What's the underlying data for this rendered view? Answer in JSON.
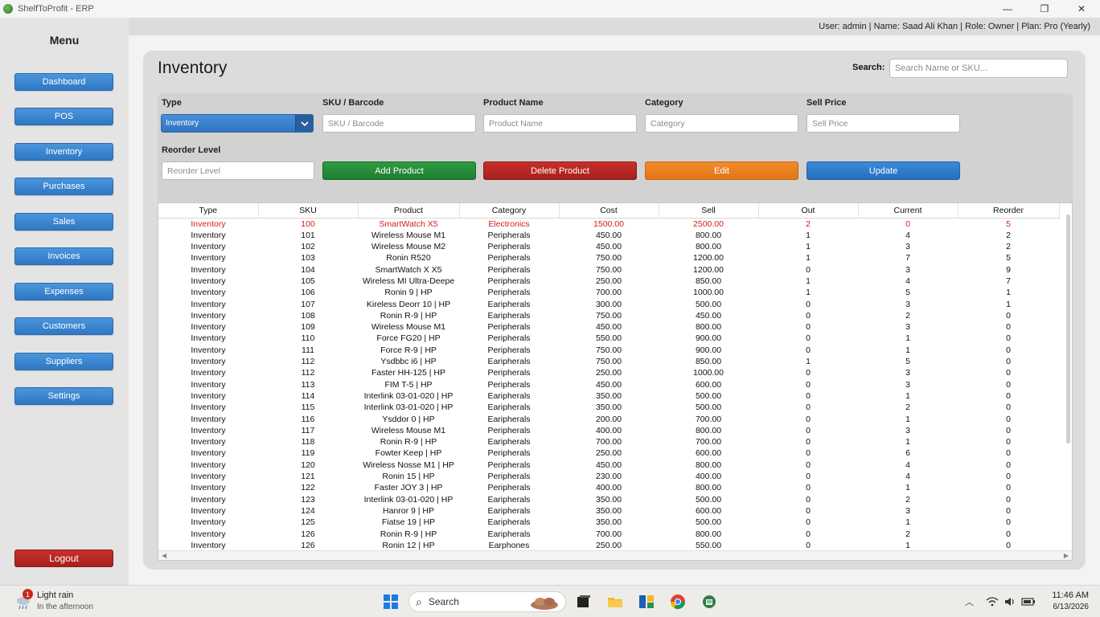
{
  "window": {
    "title": "ShelfToProfit - ERP",
    "min": "—",
    "max": "❐",
    "close": "✕"
  },
  "sidebar": {
    "menu_title": "Menu",
    "items": [
      {
        "label": "Dashboard"
      },
      {
        "label": "POS"
      },
      {
        "label": "Inventory"
      },
      {
        "label": "Purchases"
      },
      {
        "label": "Sales"
      },
      {
        "label": "Invoices"
      },
      {
        "label": "Expenses"
      },
      {
        "label": "Customers"
      },
      {
        "label": "Suppliers"
      },
      {
        "label": "Settings"
      }
    ],
    "logout": "Logout"
  },
  "infobar": {
    "text": "User: admin | Name: Saad Ali Khan | Role: Owner | Plan: Pro (Yearly)"
  },
  "page": {
    "title": "Inventory",
    "search_label": "Search:",
    "search_placeholder": "Search Name or SKU..."
  },
  "form": {
    "type_label": "Type",
    "type_value": "Inventory",
    "sku_label": "SKU / Barcode",
    "sku_placeholder": "SKU / Barcode",
    "name_label": "Product Name",
    "name_placeholder": "Product Name",
    "category_label": "Category",
    "category_placeholder": "Category",
    "sell_label": "Sell Price",
    "sell_placeholder": "Sell Price",
    "reorder_label": "Reorder Level",
    "reorder_placeholder": "Reorder Level",
    "add_label": "Add Product",
    "delete_label": "Delete Product",
    "edit_label": "Edit",
    "update_label": "Update"
  },
  "table": {
    "columns": [
      "Type",
      "SKU",
      "Product",
      "Category",
      "Cost",
      "Sell",
      "Out",
      "Current",
      "Reorder"
    ],
    "rows": [
      [
        "Inventory",
        "100",
        "SmartWatch X5",
        "Electronics",
        "1500.00",
        "2500.00",
        "2",
        "0",
        "5"
      ],
      [
        "Inventory",
        "101",
        "Wireless Mouse M1",
        "Peripherals",
        "450.00",
        "800.00",
        "1",
        "4",
        "2"
      ],
      [
        "Inventory",
        "102",
        "Wireless Mouse M2",
        "Peripherals",
        "450.00",
        "800.00",
        "1",
        "3",
        "2"
      ],
      [
        "Inventory",
        "103",
        "Ronin R520",
        "Peripherals",
        "750.00",
        "1200.00",
        "1",
        "7",
        "5"
      ],
      [
        "Inventory",
        "104",
        "SmartWatch X X5",
        "Peripherals",
        "750.00",
        "1200.00",
        "0",
        "3",
        "9"
      ],
      [
        "Inventory",
        "105",
        "Wireless MI Ultra-Deepe",
        "Peripherals",
        "250.00",
        "850.00",
        "1",
        "4",
        "7"
      ],
      [
        "Inventory",
        "106",
        "Ronin 9 | HP",
        "Peripherals",
        "700.00",
        "1000.00",
        "1",
        "5",
        "1"
      ],
      [
        "Inventory",
        "107",
        "Kireless Deorr 10 | HP",
        "Earipherals",
        "300.00",
        "500.00",
        "0",
        "3",
        "1"
      ],
      [
        "Inventory",
        "108",
        "Ronin R-9 | HP",
        "Earipherals",
        "750.00",
        "450.00",
        "0",
        "2",
        "0"
      ],
      [
        "Inventory",
        "109",
        "Wireless Mouse M1",
        "Peripherals",
        "450.00",
        "800.00",
        "0",
        "3",
        "0"
      ],
      [
        "Inventory",
        "110",
        "Force FG20 | HP",
        "Peripherals",
        "550.00",
        "900.00",
        "0",
        "1",
        "0"
      ],
      [
        "Inventory",
        "111",
        "Force R-9 | HP",
        "Peripherals",
        "750.00",
        "900.00",
        "0",
        "1",
        "0"
      ],
      [
        "Inventory",
        "112",
        "Ysdbbc i6 | HP",
        "Earipherals",
        "750.00",
        "850.00",
        "1",
        "5",
        "0"
      ],
      [
        "Inventory",
        "112",
        "Faster HH-125 | HP",
        "Peripherals",
        "250.00",
        "1000.00",
        "0",
        "3",
        "0"
      ],
      [
        "Inventory",
        "113",
        "FIM T-5 | HP",
        "Peripherals",
        "450.00",
        "600.00",
        "0",
        "3",
        "0"
      ],
      [
        "Inventory",
        "114",
        "Interlink 03-01-020 | HP",
        "Earipherals",
        "350.00",
        "500.00",
        "0",
        "1",
        "0"
      ],
      [
        "Inventory",
        "115",
        "Interlink 03-01-020 | HP",
        "Earipherals",
        "350.00",
        "500.00",
        "0",
        "2",
        "0"
      ],
      [
        "Inventory",
        "116",
        "Ysddor 0 | HP",
        "Earipherals",
        "200.00",
        "700.00",
        "0",
        "1",
        "0"
      ],
      [
        "Inventory",
        "117",
        "Wireless Mouse M1",
        "Peripherals",
        "400.00",
        "800.00",
        "0",
        "3",
        "0"
      ],
      [
        "Inventory",
        "118",
        "Ronin R-9 | HP",
        "Earipherals",
        "700.00",
        "700.00",
        "0",
        "1",
        "0"
      ],
      [
        "Inventory",
        "119",
        "Fowter Keep | HP",
        "Peripherals",
        "250.00",
        "600.00",
        "0",
        "6",
        "0"
      ],
      [
        "Inventory",
        "120",
        "Wireless Nosse M1 | HP",
        "Peripherals",
        "450.00",
        "800.00",
        "0",
        "4",
        "0"
      ],
      [
        "Inventory",
        "121",
        "Ronin 15 | HP",
        "Peripherals",
        "230.00",
        "400.00",
        "0",
        "4",
        "0"
      ],
      [
        "Inventory",
        "122",
        "Faster JOY 3 | HP",
        "Peripherals",
        "400.00",
        "800.00",
        "0",
        "1",
        "0"
      ],
      [
        "Inventory",
        "123",
        "Interlink 03-01-020 | HP",
        "Earipherals",
        "350.00",
        "500.00",
        "0",
        "2",
        "0"
      ],
      [
        "Inventory",
        "124",
        "Hanror 9 | HP",
        "Earipherals",
        "350.00",
        "600.00",
        "0",
        "3",
        "0"
      ],
      [
        "Inventory",
        "125",
        "Fiatse 19 | HP",
        "Earipherals",
        "350.00",
        "500.00",
        "0",
        "1",
        "0"
      ],
      [
        "Inventory",
        "126",
        "Ronin R-9 | HP",
        "Earipherals",
        "700.00",
        "800.00",
        "0",
        "2",
        "0"
      ],
      [
        "Inventory",
        "126",
        "Ronin 12 | HP",
        "Earphones",
        "250.00",
        "550.00",
        "0",
        "1",
        "0"
      ]
    ]
  },
  "taskbar": {
    "weather_title": "Light rain",
    "weather_sub": "In the afternoon",
    "weather_badge": "1",
    "search_label": "Search",
    "time": "11:46 AM",
    "date": "6/13/2026"
  },
  "colors": {
    "accent": "#2f78c4",
    "danger": "#c9302c",
    "success": "#2f9a42",
    "warning": "#f28a2c",
    "low_stock": "#d12020"
  }
}
